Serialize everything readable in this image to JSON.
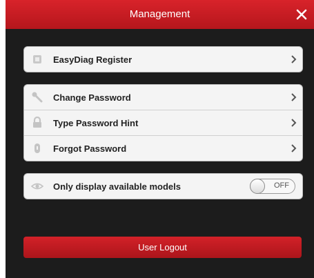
{
  "window": {
    "title": "Management"
  },
  "register_group": {
    "items": [
      {
        "label": "EasyDiag Register",
        "icon": "register-icon"
      }
    ]
  },
  "password_group": {
    "items": [
      {
        "label": "Change Password",
        "icon": "key-icon"
      },
      {
        "label": "Type Password Hint",
        "icon": "lock-icon"
      },
      {
        "label": "Forgot Password",
        "icon": "padlock-icon"
      }
    ]
  },
  "display_group": {
    "label": "Only display available models",
    "icon": "eye-icon",
    "toggle_state": "OFF"
  },
  "logout": {
    "label": "User Logout"
  },
  "colors": {
    "accent": "#c81c22",
    "background": "#1c1c1c",
    "row_bg": "#f4f4f4"
  }
}
